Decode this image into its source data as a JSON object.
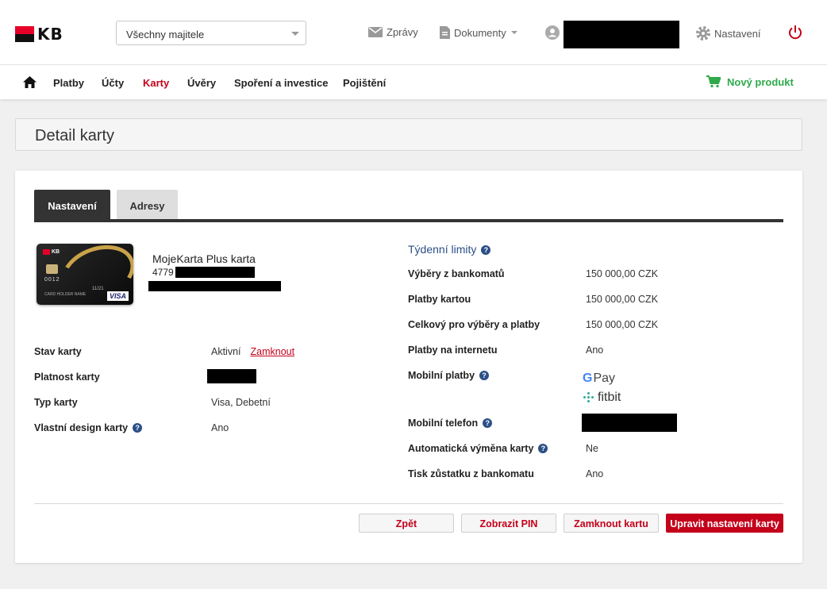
{
  "brand": {
    "logo_text": "KB",
    "accent": "#c4001a",
    "logo_red": "#e60028"
  },
  "header": {
    "owner_select_value": "Všechny majitele",
    "messages_label": "Zprávy",
    "documents_label": "Dokumenty",
    "settings_label": "Nastavení"
  },
  "nav": {
    "items": [
      "Platby",
      "Účty",
      "Karty",
      "Úvěry",
      "Spoření a investice",
      "Pojištění"
    ],
    "active": "Karty",
    "new_product": "Nový produkt"
  },
  "page": {
    "title": "Detail karty"
  },
  "tabs": {
    "active": "Nastavení",
    "inactive": "Adresy"
  },
  "card": {
    "name": "MojeKarta Plus karta",
    "number_prefix": "4779",
    "image": {
      "number": "0012",
      "expiry": "11/21",
      "holder": "CARD HOLDER NAME",
      "network": "VISA"
    }
  },
  "details": {
    "status_label": "Stav karty",
    "status_value": "Aktivní",
    "lock_link": "Zamknout",
    "validity_label": "Platnost karty",
    "type_label": "Typ karty",
    "type_value": "Visa, Debetní",
    "design_label": "Vlastní design karty",
    "design_value": "Ano"
  },
  "limits": {
    "title": "Týdenní limity",
    "atm_label": "Výběry z bankomatů",
    "atm_value": "150 000,00 CZK",
    "card_label": "Platby kartou",
    "card_value": "150 000,00 CZK",
    "total_label": "Celkový pro výběry a platby",
    "total_value": "150 000,00 CZK",
    "internet_label": "Platby na internetu",
    "internet_value": "Ano",
    "mobile_pay_label": "Mobilní platby",
    "gpay": "Pay",
    "fitbit": "fitbit",
    "phone_label": "Mobilní telefon",
    "auto_replace_label": "Automatická výměna karty",
    "auto_replace_value": "Ne",
    "balance_print_label": "Tisk zůstatku z bankomatu",
    "balance_print_value": "Ano"
  },
  "buttons": {
    "back": "Zpět",
    "show_pin": "Zobrazit PIN",
    "lock_card": "Zamknout kartu",
    "edit_settings": "Upravit nastavení karty"
  }
}
